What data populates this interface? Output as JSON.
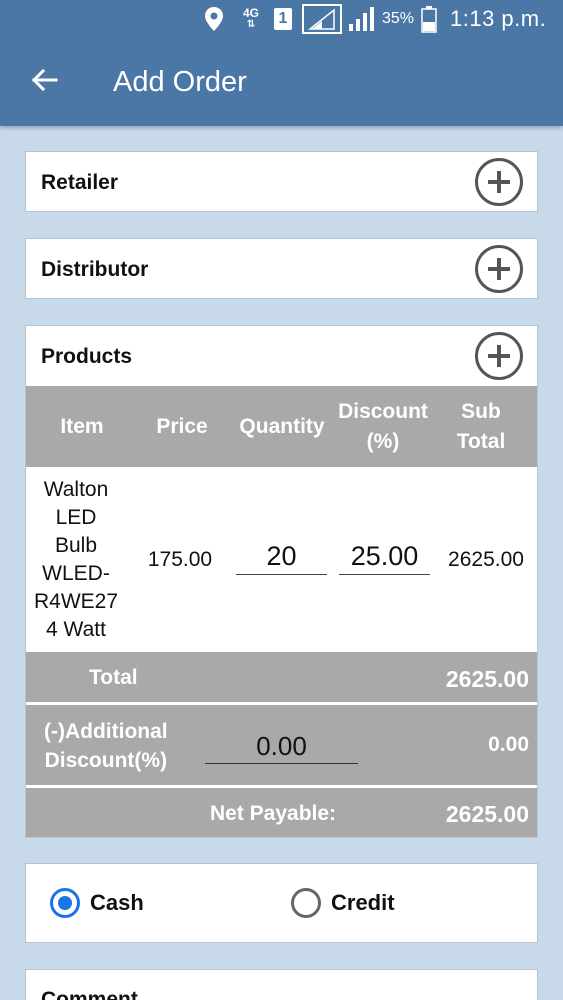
{
  "status_bar": {
    "network": "4G",
    "sim": "1",
    "battery_percent": "35%",
    "time": "1:13 p.m.",
    "icons": [
      "location-icon",
      "network-4g-icon",
      "sim-icon",
      "signal-icon",
      "signal-icon",
      "battery-icon"
    ]
  },
  "app_bar": {
    "title": "Add Order",
    "back_icon": "arrow-left-icon"
  },
  "sections": {
    "retailer": "Retailer",
    "distributor": "Distributor",
    "products": "Products"
  },
  "products_table": {
    "headers": {
      "item": "Item",
      "price": "Price",
      "quantity": "Quantity",
      "discount_1": "Discount",
      "discount_2": "(%)",
      "subtotal_1": "Sub",
      "subtotal_2": "Total"
    },
    "rows": [
      {
        "item_lines": [
          "Walton",
          "LED",
          "Bulb",
          "WLED-",
          "R4WE27",
          "4 Watt"
        ],
        "price": "175.00",
        "quantity": "20",
        "discount": "25.00",
        "subtotal": "2625.00"
      }
    ]
  },
  "totals": {
    "total_label": "Total",
    "total_value": "2625.00",
    "additional_discount_label_1": "(-)Additional",
    "additional_discount_label_2": "Discount(%)",
    "additional_discount_input": "0.00",
    "additional_discount_value": "0.00",
    "net_payable_label": "Net Payable:",
    "net_payable_value": "2625.00"
  },
  "payment": {
    "cash_label": "Cash",
    "credit_label": "Credit",
    "selected": "Cash"
  },
  "comment": {
    "label": "Comment"
  },
  "colors": {
    "primary": "#4a77a6",
    "background": "#c8d9ea",
    "table_header": "#a9a9a9",
    "radio_accent": "#1a73e8"
  }
}
